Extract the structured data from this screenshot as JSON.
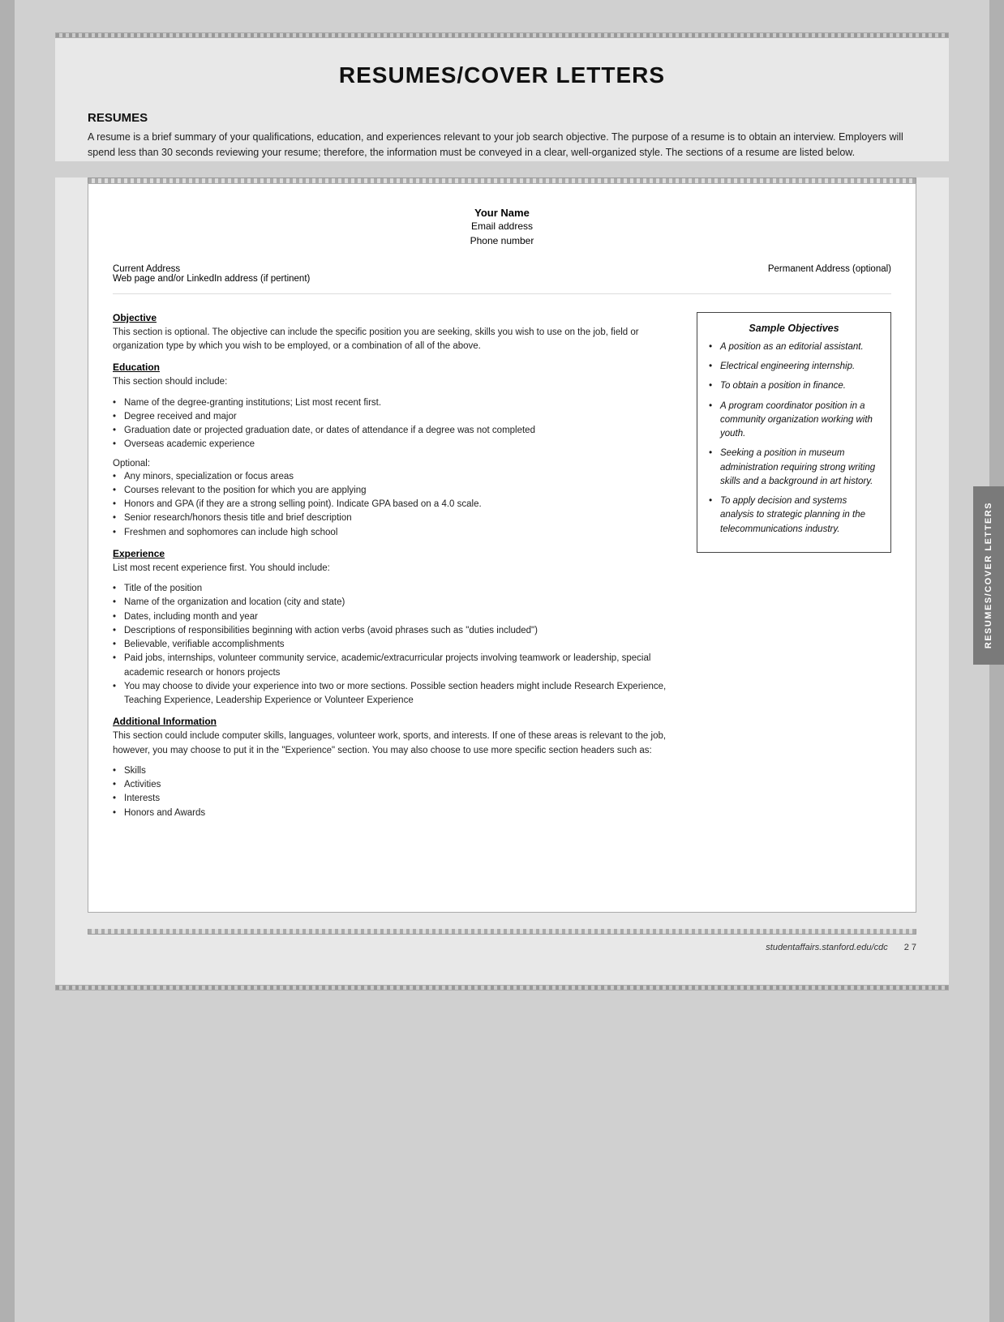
{
  "page": {
    "title": "RESUMES/COVER LETTERS",
    "footer_url": "studentaffairs.stanford.edu/cdc",
    "footer_page": "2  7"
  },
  "resumes_section": {
    "heading": "RESUMES",
    "intro": "A resume is a brief summary of your qualifications, education, and experiences relevant to your job search objective. The purpose of a resume is to obtain an interview. Employers will spend less than 30 seconds reviewing your resume; therefore, the information must be conveyed in a clear, well-organized style. The sections of a resume are listed below."
  },
  "resume_template": {
    "name": "Your Name",
    "email": "Email address",
    "phone": "Phone number",
    "current_address": "Current Address",
    "web_address": "Web page and/or LinkedIn address (if pertinent)",
    "permanent_address": "Permanent Address (optional)"
  },
  "objective_section": {
    "title": "Objective",
    "body": "This section is optional. The objective can include the specific position you are seeking, skills you wish to use on the job, field or organization type by which you wish to be employed, or a combination of all of the above."
  },
  "sample_objectives": {
    "title": "Sample Objectives",
    "items": [
      "A position as an editorial assistant.",
      "Electrical engineering internship.",
      "To obtain a position in finance.",
      "A program coordinator position in a community organization working with youth.",
      "Seeking a position in museum administration requiring strong writing skills and a background in art history.",
      "To apply decision and systems analysis to strategic planning in the telecommunications industry."
    ]
  },
  "education_section": {
    "title": "Education",
    "body": "This section should include:",
    "bullets": [
      "Name of the degree-granting institutions; List most recent first.",
      "Degree received and major",
      "Graduation date or projected graduation date, or dates of attendance if a degree was not completed",
      "Overseas academic experience"
    ],
    "optional_label": "Optional:",
    "optional_bullets": [
      "Any minors, specialization or focus areas",
      "Courses relevant to the position for which you are applying",
      "Honors and GPA (if they are a strong selling point). Indicate GPA based on a 4.0 scale.",
      "Senior research/honors thesis title and brief description",
      "Freshmen and sophomores can include high school"
    ]
  },
  "experience_section": {
    "title": "Experience",
    "body": "List most recent experience first. You should include:",
    "bullets": [
      "Title of the position",
      "Name of the organization and location (city and state)",
      "Dates, including month and year",
      "Descriptions of responsibilities beginning with action verbs (avoid phrases such as \"duties included\")",
      "Believable, verifiable accomplishments",
      "Paid jobs, internships, volunteer community service, academic/extracurricular projects involving teamwork or leadership, special academic research or honors projects",
      "You may choose to divide your experience into two or more sections. Possible section headers might include Research Experience, Teaching Experience, Leadership Experience or Volunteer Experience"
    ]
  },
  "additional_info_section": {
    "title": "Additional Information",
    "body": "This section could include computer skills, languages, volunteer work, sports, and interests. If one of these areas is relevant to the job, however, you may choose to put it in the \"Experience\" section. You may also choose to use more specific section headers such as:",
    "bullets": [
      "Skills",
      "Activities",
      "Interests",
      "Honors and Awards"
    ]
  },
  "right_tab_label": "RESUMES/COVER LETTERS"
}
